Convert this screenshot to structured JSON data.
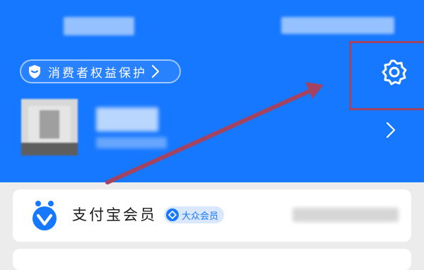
{
  "header": {
    "background_color": "#1677ff",
    "consumer_protection": {
      "label": "消费者权益保护",
      "shield_icon": "shield-icon",
      "chevron_icon": "chevron-right-icon"
    },
    "settings_icon": "gear-icon",
    "profile": {
      "chevron_icon": "chevron-right-icon"
    }
  },
  "member_card": {
    "title": "支付宝会员",
    "level_badge": "大众会员",
    "logo_icon": "alipay-member-logo",
    "accent_color": "#1677ff"
  },
  "annotation": {
    "box_color": "#a24362",
    "arrow_color": "#a24362"
  }
}
